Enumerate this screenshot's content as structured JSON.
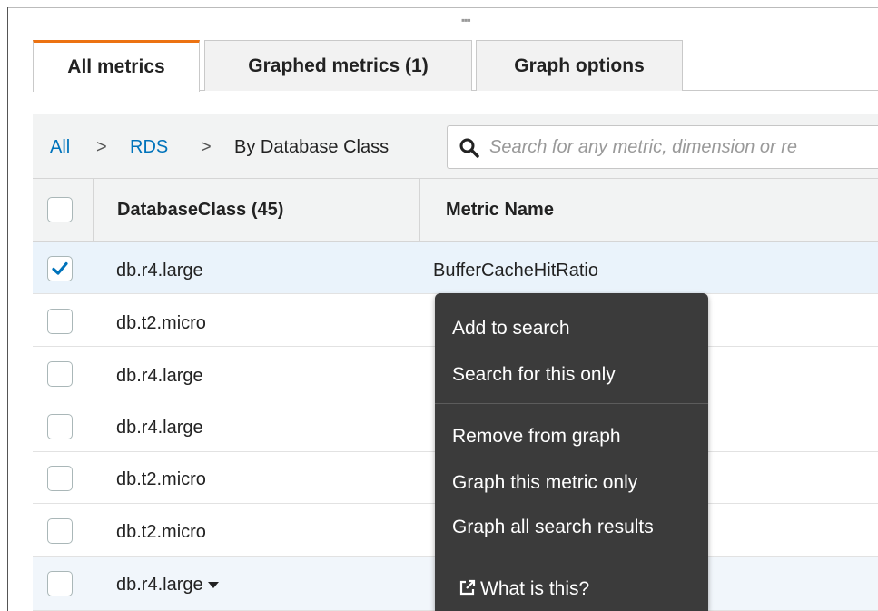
{
  "tabs": [
    {
      "label": "All metrics",
      "active": true
    },
    {
      "label": "Graphed metrics (1)",
      "active": false
    },
    {
      "label": "Graph options",
      "active": false
    }
  ],
  "breadcrumb": {
    "items": [
      "All",
      "RDS",
      "By Database Class"
    ],
    "separator": ">"
  },
  "search": {
    "placeholder": "Search for any metric, dimension or re",
    "value": ""
  },
  "table": {
    "columns": [
      "DatabaseClass (45)",
      "Metric Name"
    ],
    "rows": [
      {
        "database_class": "db.r4.large",
        "metric_name": "BufferCacheHitRatio",
        "checked": true
      },
      {
        "database_class": "db.t2.micro",
        "metric_name": "",
        "checked": false
      },
      {
        "database_class": "db.r4.large",
        "metric_name": "",
        "checked": false
      },
      {
        "database_class": "db.r4.large",
        "metric_name": "",
        "checked": false
      },
      {
        "database_class": "db.t2.micro",
        "metric_name": "",
        "checked": false
      },
      {
        "database_class": "db.t2.micro",
        "metric_name": "",
        "checked": false
      },
      {
        "database_class": "db.r4.large",
        "metric_name": "",
        "checked": false
      }
    ]
  },
  "context_menu": {
    "groups": [
      [
        "Add to search",
        "Search for this only"
      ],
      [
        "Remove from graph",
        "Graph this metric only",
        "Graph all search results"
      ],
      [
        "What is this?"
      ]
    ]
  },
  "icons": {
    "drag_handle": "drag-handle-icon",
    "search": "search-icon",
    "check": "checkmark-icon",
    "dropdown": "caret-down-icon",
    "external_link": "external-link-icon"
  },
  "colors": {
    "active_tab_accent": "#ec7211",
    "link": "#0073bb",
    "selected_row": "#eaf3fb",
    "checkbox_check": "#0073bb",
    "menu_background": "#3b3b3b"
  }
}
